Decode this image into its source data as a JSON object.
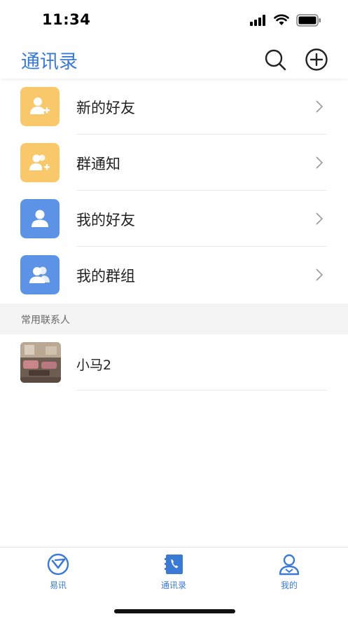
{
  "status_bar": {
    "time": "11:34"
  },
  "nav": {
    "title": "通讯录",
    "search_icon": "search-icon",
    "add_icon": "plus-circle-icon"
  },
  "menu": {
    "items": [
      {
        "label": "新的好友",
        "icon": "add-friend-icon",
        "color": "#f9c86a"
      },
      {
        "label": "群通知",
        "icon": "group-notice-icon",
        "color": "#f9c86a"
      },
      {
        "label": "我的好友",
        "icon": "user-icon",
        "color": "#5d93e6"
      },
      {
        "label": "我的群组",
        "icon": "group-icon",
        "color": "#5d93e6"
      }
    ]
  },
  "frequent_contacts": {
    "title": "常用联系人",
    "items": [
      {
        "name": "小马2",
        "avatar": "photo-avatar"
      }
    ]
  },
  "tab_bar": {
    "accent": "#3a7ad4",
    "tabs": [
      {
        "label": "易讯",
        "icon": "message-icon"
      },
      {
        "label": "通讯录",
        "icon": "contacts-book-icon"
      },
      {
        "label": "我的",
        "icon": "profile-icon"
      }
    ]
  }
}
